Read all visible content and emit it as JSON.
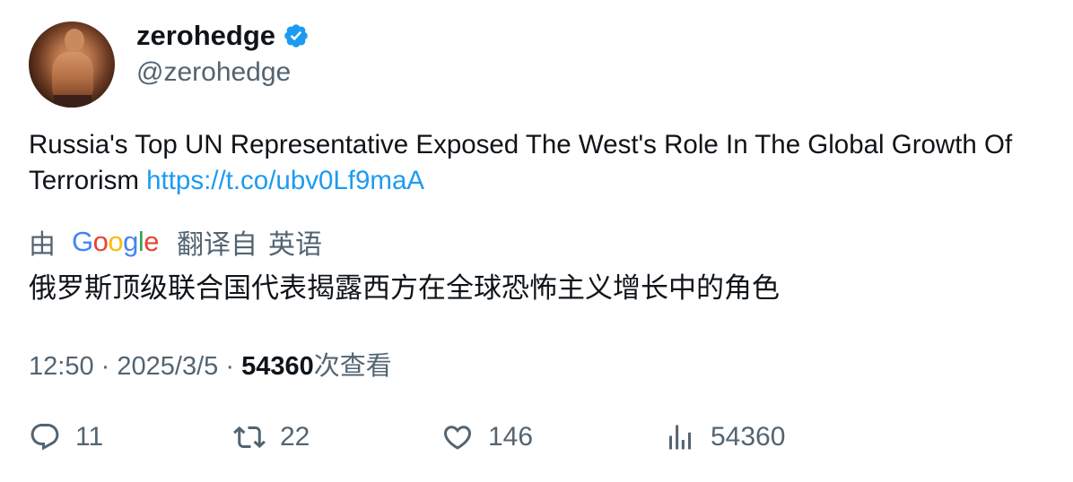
{
  "author": {
    "display_name": "zerohedge",
    "handle": "@zerohedge",
    "verified": true,
    "verified_color": "#1d9bf0"
  },
  "tweet": {
    "text": "Russia's Top UN Representative Exposed The West's Role In The Global Growth Of Terrorism",
    "link": "https://t.co/ubv0Lf9maA"
  },
  "translation": {
    "by_label": "由",
    "provider": [
      "G",
      "o",
      "o",
      "g",
      "l",
      "e"
    ],
    "provider_colors": [
      "#4285f4",
      "#ea4335",
      "#fbbc05",
      "#4285f4",
      "#34a853",
      "#ea4335"
    ],
    "from_label": "翻译自",
    "language": "英语",
    "text": "俄罗斯顶级联合国代表揭露西方在全球恐怖主义增长中的角色"
  },
  "meta": {
    "time": "12:50",
    "separator": "·",
    "date": "2025/3/5",
    "views_count": "54360",
    "views_label": "次查看"
  },
  "actions": {
    "reply": {
      "icon": "reply-icon",
      "count": "11"
    },
    "retweet": {
      "icon": "retweet-icon",
      "count": "22"
    },
    "like": {
      "icon": "heart-icon",
      "count": "146"
    },
    "views": {
      "icon": "analytics-icon",
      "count": "54360"
    }
  }
}
